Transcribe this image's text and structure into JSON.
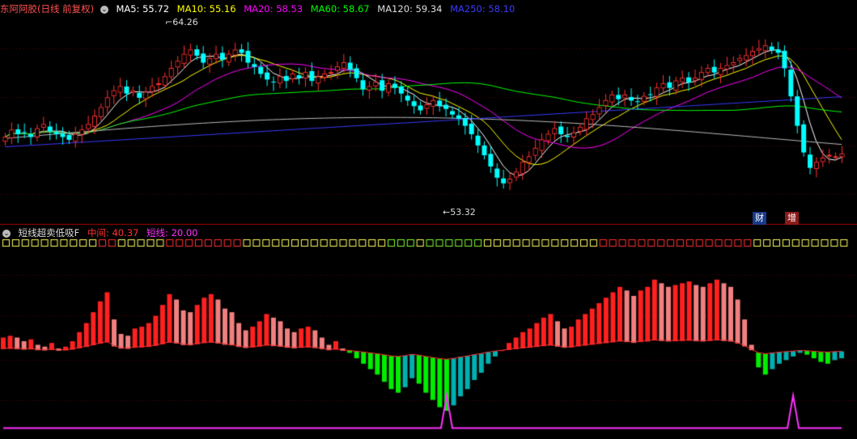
{
  "main": {
    "title": "东阿阿胶(日线 前复权)",
    "ma": [
      {
        "name": "MA5",
        "label": "MA5: 55.72",
        "color": "#ffffff"
      },
      {
        "name": "MA10",
        "label": "MA10: 55.16",
        "color": "#ffff00"
      },
      {
        "name": "MA20",
        "label": "MA20: 58.53",
        "color": "#ff00ff"
      },
      {
        "name": "MA60",
        "label": "MA60: 58.67",
        "color": "#00ff00"
      },
      {
        "name": "MA120",
        "label": "MA120: 59.34",
        "color": "#dddddd"
      },
      {
        "name": "MA250",
        "label": "MA250: 58.10",
        "color": "#3a3aff"
      }
    ],
    "high_label": "64.26",
    "low_label": "53.32",
    "flag_cai": "财",
    "flag_zeng": "增"
  },
  "sub": {
    "title": "短线超卖低吸F",
    "mid_label": "中间: 40.37",
    "short_label": "短线: 20.00",
    "mid_color": "#ff3030",
    "short_color": "#ff30ff"
  },
  "colors": {
    "up": "#ff3030",
    "down": "#00ffff",
    "sub_red": "#ff2020",
    "sub_salmon": "#f08080",
    "sub_green": "#00ee00",
    "sub_cyan": "#00b0b0",
    "grid_sep": "#aa0000"
  },
  "chart_data": [
    {
      "type": "candlestick",
      "title": "东阿阿胶(日线 前复权)",
      "annotations": [
        "64.26",
        "53.32"
      ],
      "series_high": 64.26,
      "series_low": 53.32,
      "ylim": [
        52.2,
        65.8
      ],
      "close": [
        57.3,
        57.8,
        57.5,
        57.6,
        57.3,
        57.9,
        58.2,
        57.7,
        57.5,
        57.3,
        57.1,
        57.5,
        57.8,
        58.2,
        58.8,
        59.4,
        60.1,
        60.6,
        60.9,
        60.4,
        60.6,
        60.1,
        60.5,
        60.9,
        61.1,
        61.6,
        62.2,
        62.7,
        63.2,
        63.5,
        63.1,
        62.6,
        62.9,
        63.2,
        62.8,
        63.2,
        63.5,
        63.3,
        62.6,
        62.3,
        61.8,
        61.4,
        61.2,
        61.6,
        61.3,
        61.8,
        61.5,
        61.9,
        61.3,
        61.6,
        61.8,
        61.9,
        62.3,
        62.6,
        62.1,
        61.5,
        60.7,
        60.9,
        61.2,
        60.6,
        61.1,
        60.8,
        60.4,
        59.9,
        59.5,
        59.2,
        59.6,
        59.9,
        59.5,
        59.3,
        58.9,
        58.6,
        58.1,
        57.5,
        56.7,
        56.0,
        55.2,
        54.4,
        54.0,
        54.3,
        54.8,
        55.5,
        55.9,
        56.5,
        57.1,
        57.5,
        57.9,
        57.5,
        57.3,
        57.6,
        58.0,
        58.6,
        58.9,
        59.4,
        59.9,
        60.3,
        60.0,
        60.3,
        59.9,
        59.8,
        60.2,
        60.3,
        60.8,
        61.1,
        60.8,
        61.3,
        61.5,
        61.2,
        61.5,
        61.9,
        62.2,
        61.9,
        62.2,
        62.4,
        62.6,
        62.9,
        63.1,
        63.4,
        63.6,
        63.8,
        63.5,
        63.3,
        62.2,
        60.2,
        58.1,
        56.2,
        55.1,
        55.5,
        55.8,
        56.0,
        55.9,
        56.1
      ]
    },
    {
      "type": "bar",
      "title": "短线超卖低吸F",
      "series": [
        {
          "name": "中间",
          "last": 40.37
        },
        {
          "name": "短线",
          "last": 20.0
        }
      ],
      "ylim": [
        0,
        100
      ],
      "values": [
        52,
        53,
        52,
        50,
        51,
        48,
        47,
        49,
        46,
        47,
        50,
        55,
        60,
        66,
        72,
        77,
        62,
        54,
        53,
        57,
        58,
        60,
        64,
        70,
        76,
        73,
        67,
        66,
        70,
        74,
        76,
        73,
        68,
        66,
        60,
        56,
        58,
        61,
        65,
        63,
        61,
        57,
        55,
        57,
        58,
        56,
        52,
        48,
        50,
        46,
        44,
        41,
        38,
        35,
        32,
        28,
        24,
        22,
        25,
        30,
        27,
        22,
        18,
        14,
        12,
        15,
        20,
        24,
        29,
        33,
        38,
        42,
        45,
        49,
        52,
        55,
        57,
        60,
        63,
        65,
        61,
        57,
        58,
        62,
        65,
        68,
        71,
        74,
        77,
        80,
        78,
        75,
        78,
        80,
        84,
        82,
        80,
        81,
        82,
        83,
        81,
        80,
        82,
        84,
        82,
        80,
        73,
        62,
        48,
        36,
        32,
        35,
        38,
        40,
        42,
        44,
        43,
        41,
        39,
        38,
        40,
        41
      ],
      "short_line": {
        "base": 2,
        "spike_indices": [
          64,
          114
        ],
        "spike_value": 20
      }
    }
  ]
}
